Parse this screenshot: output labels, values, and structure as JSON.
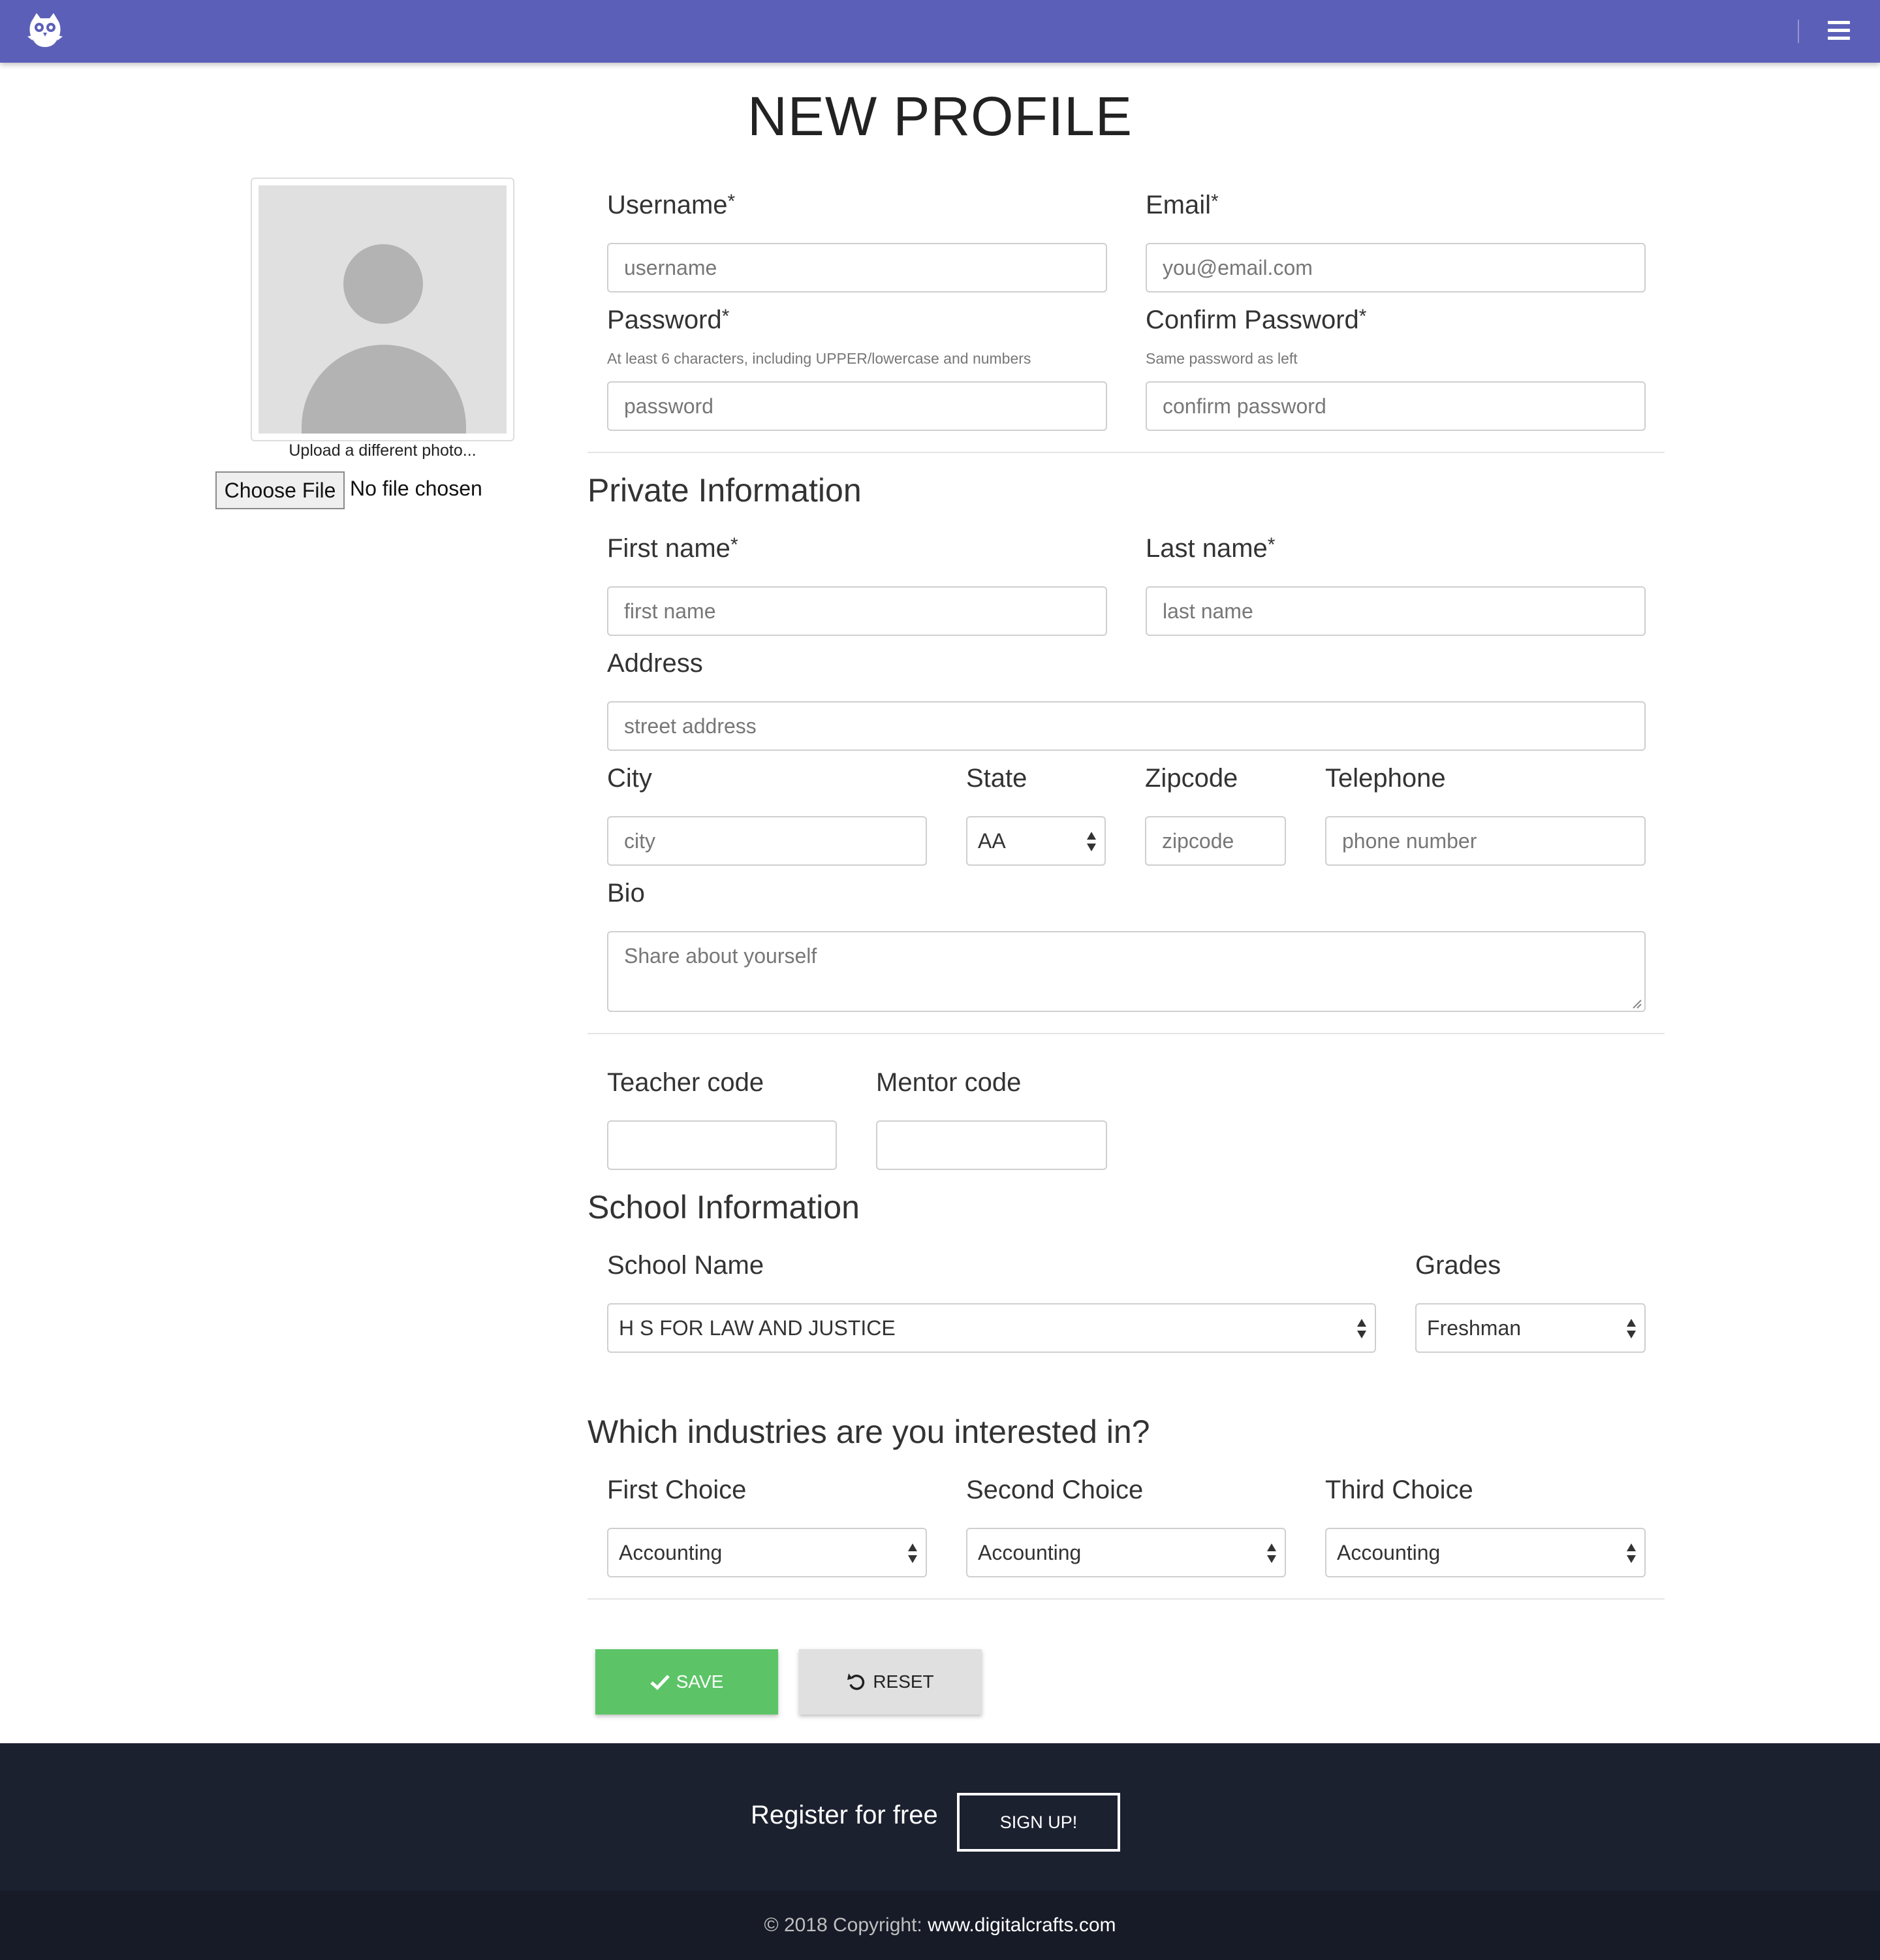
{
  "header": {
    "logo_icon": "owl-logo-icon",
    "menu_icon": "hamburger-menu-icon"
  },
  "page": {
    "title": "NEW PROFILE"
  },
  "photo": {
    "caption": "Upload a different photo...",
    "choose_file_label": "Choose File",
    "file_status": "No file chosen"
  },
  "account": {
    "username": {
      "label": "Username",
      "required_mark": "*",
      "placeholder": "username"
    },
    "email": {
      "label": "Email",
      "required_mark": "*",
      "placeholder": "you@email.com"
    },
    "password": {
      "label": "Password",
      "required_mark": "*",
      "hint": "At least 6 characters, including UPPER/lowercase and numbers",
      "placeholder": "password"
    },
    "confirm_password": {
      "label": "Confirm Password",
      "required_mark": "*",
      "hint": "Same password as left",
      "placeholder": "confirm password"
    }
  },
  "private": {
    "title": "Private Information",
    "first_name": {
      "label": "First name",
      "required_mark": "*",
      "placeholder": "first name"
    },
    "last_name": {
      "label": "Last name",
      "required_mark": "*",
      "placeholder": "last name"
    },
    "address": {
      "label": "Address",
      "placeholder": "street address"
    },
    "city": {
      "label": "City",
      "placeholder": "city"
    },
    "state": {
      "label": "State",
      "value": "AA"
    },
    "zipcode": {
      "label": "Zipcode",
      "placeholder": "zipcode"
    },
    "telephone": {
      "label": "Telephone",
      "placeholder": "phone number"
    },
    "bio": {
      "label": "Bio",
      "placeholder": "Share about yourself"
    }
  },
  "codes": {
    "teacher": {
      "label": "Teacher code"
    },
    "mentor": {
      "label": "Mentor code"
    }
  },
  "school": {
    "title": "School Information",
    "name": {
      "label": "School Name",
      "value": "H S FOR LAW AND JUSTICE"
    },
    "grades": {
      "label": "Grades",
      "value": "Freshman"
    }
  },
  "industries": {
    "title": "Which industries are you interested in?",
    "choices": [
      {
        "label": "First Choice",
        "value": "Accounting"
      },
      {
        "label": "Second Choice",
        "value": "Accounting"
      },
      {
        "label": "Third Choice",
        "value": "Accounting"
      }
    ]
  },
  "actions": {
    "save_label": "SAVE",
    "save_icon": "check-icon",
    "reset_label": "RESET",
    "reset_icon": "undo-icon"
  },
  "footer": {
    "register_text": "Register for free",
    "signup_label": "SIGN UP!",
    "copyright_prefix": "© 2018 Copyright: ",
    "copyright_link": "www.digitalcrafts.com"
  },
  "colors": {
    "header": "#5c5fb8",
    "save": "#5cc466",
    "reset": "#e0e0e0",
    "footer": "#1c2130",
    "copyright_bar": "#171b27"
  }
}
